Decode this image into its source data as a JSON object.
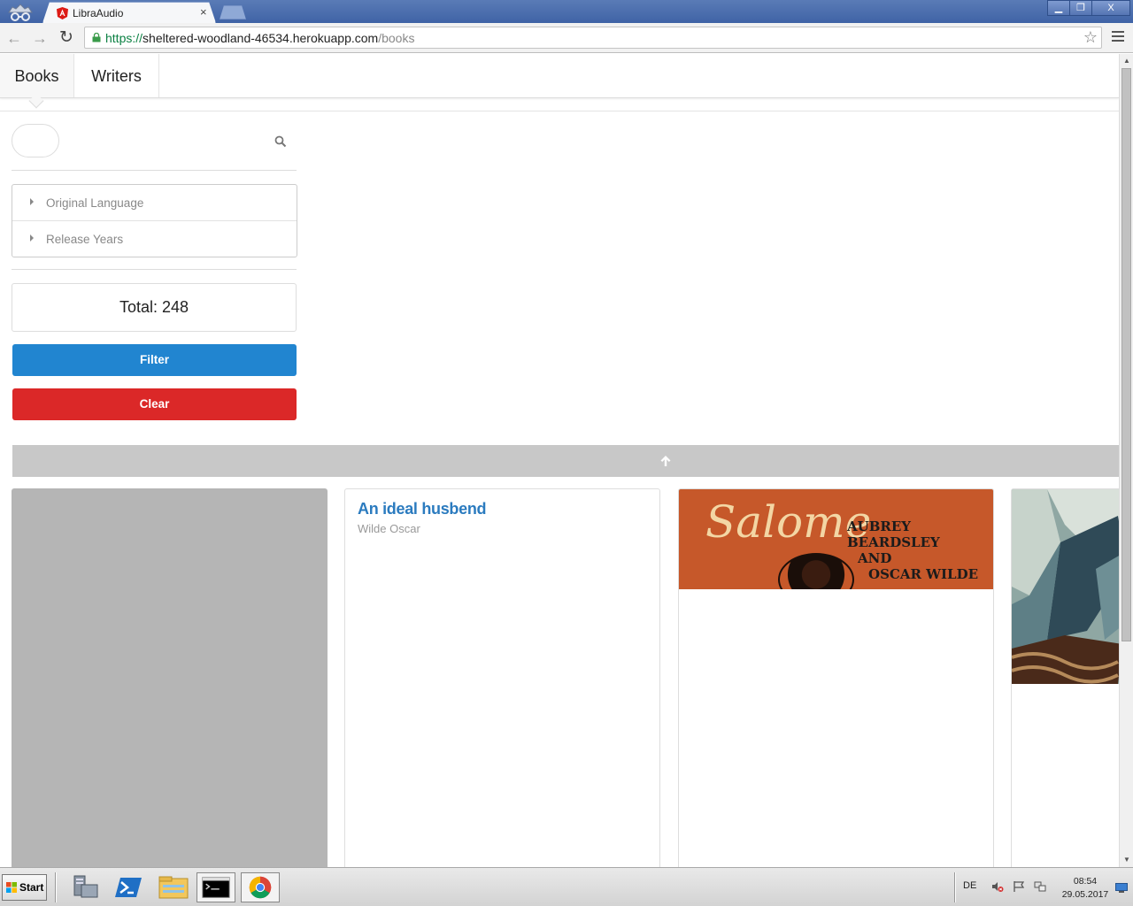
{
  "browser": {
    "tab_title": "LibraAudio",
    "tab_close": "×",
    "url_scheme": "https://",
    "url_host": "sheltered-woodland-46534.herokuapp.com",
    "url_path": "/books",
    "window_buttons": {
      "minimize": "▁",
      "maximize": "❐",
      "close": "X"
    },
    "nav": {
      "back": "←",
      "forward": "→",
      "reload": "↻",
      "bookmark": "☆"
    }
  },
  "app": {
    "nav_tabs": [
      {
        "label": "Books",
        "active": true
      },
      {
        "label": "Writers",
        "active": false
      }
    ],
    "search": {
      "placeholder": "",
      "value": ""
    },
    "filters": [
      {
        "label": "Original Language",
        "expanded": false
      },
      {
        "label": "Release Years",
        "expanded": false
      }
    ],
    "total_label": "Total: 248",
    "filter_button": "Filter",
    "clear_button": "Clear",
    "colors": {
      "primary": "#2185d0",
      "danger": "#db2828",
      "link": "#2b7bbf"
    },
    "books": [
      {
        "title": "",
        "author": "",
        "cover": "placeholder-gray"
      },
      {
        "title": "An ideal husbend",
        "author": "Wilde Oscar",
        "cover": "none"
      },
      {
        "title": "",
        "author": "",
        "cover": "salome-cover",
        "cover_text": {
          "title": "Salome",
          "line1": "AUBREY BEARDSLEY",
          "line2": "AND",
          "line3": "OSCAR WILDE"
        }
      },
      {
        "title": "",
        "author": "",
        "cover": "painting-cover"
      }
    ]
  },
  "taskbar": {
    "start_label": "Start",
    "language": "DE",
    "time": "08:54",
    "date": "29.05.2017",
    "apps": [
      "server-manager-icon",
      "powershell-icon",
      "file-explorer-icon",
      "cmd-icon",
      "chrome-icon"
    ]
  }
}
